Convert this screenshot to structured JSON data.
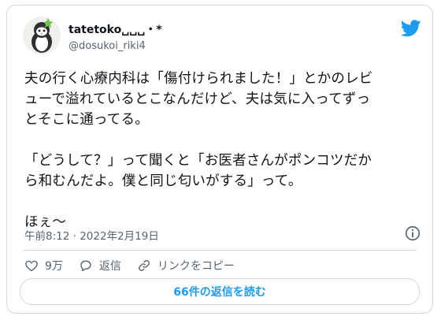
{
  "tweet": {
    "author_name": "tatetoko␣␣␣・*",
    "author_handle": "@dosukoi_riki4",
    "text_lines": [
      "夫の行く心療内科は「傷付けられました！」とかのレビ",
      "ューで溢れているとこなんだけど、夫は気に入ってずっ",
      "とそこに通ってる。",
      "",
      "「どうして？」って聞くと「お医者さんがポンコツだか",
      "ら和むんだよ。僕と同じ匂いがする」って。",
      "",
      "ほぇ〜"
    ],
    "timestamp": "午前8:12 · 2022年2月19日",
    "likes_count": "9万",
    "reply_label": "返信",
    "copy_link_label": "リンクをコピー",
    "read_replies_button": "66件の返信を読む"
  },
  "icons": {
    "brand": "twitter-bird-icon",
    "info": "info-icon",
    "like": "heart-icon",
    "reply": "reply-bubble-icon",
    "link": "link-icon"
  },
  "colors": {
    "brand_blue": "#1d9bf0",
    "text_primary": "#0f1419",
    "text_secondary": "#536471",
    "border": "#cfd9de"
  }
}
